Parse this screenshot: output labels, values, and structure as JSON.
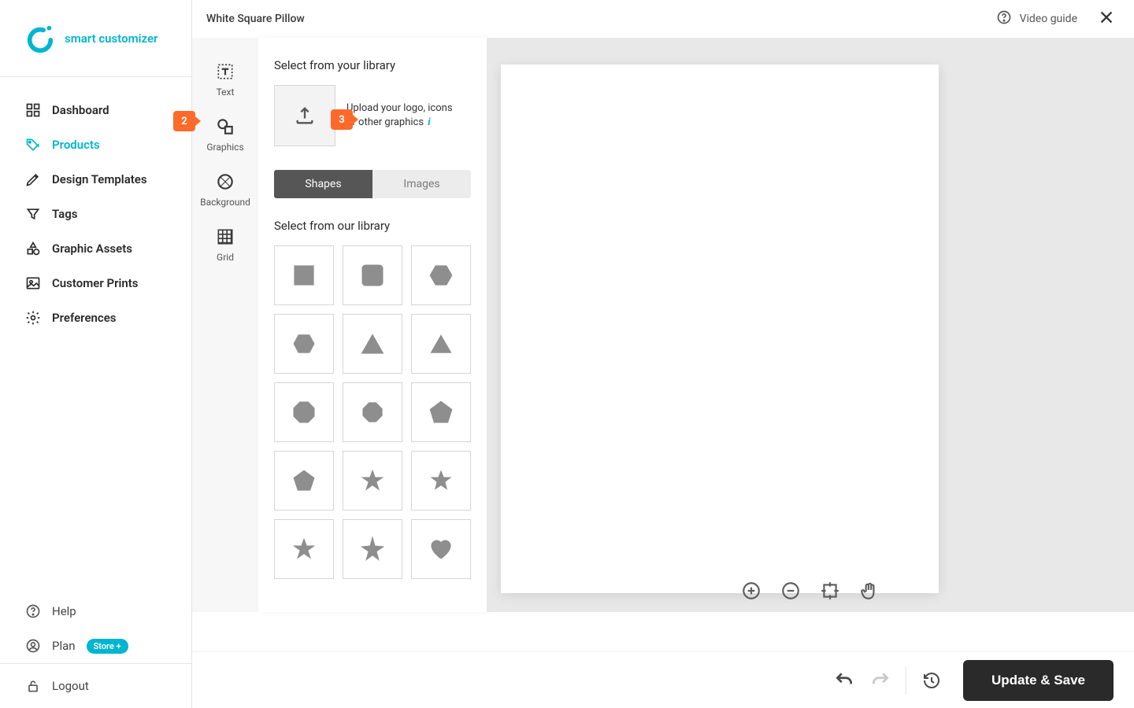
{
  "brand": {
    "name": "smart customizer"
  },
  "nav": {
    "items": [
      {
        "label": "Dashboard"
      },
      {
        "label": "Products"
      },
      {
        "label": "Design Templates"
      },
      {
        "label": "Tags"
      },
      {
        "label": "Graphic Assets"
      },
      {
        "label": "Customer Prints"
      },
      {
        "label": "Preferences"
      }
    ],
    "active_index": 1
  },
  "footer": {
    "help": "Help",
    "plan": "Plan",
    "plan_badge": "Store +",
    "logout": "Logout"
  },
  "topbar": {
    "title": "White Square Pillow",
    "video_guide": "Video guide"
  },
  "tools": [
    {
      "label": "Text"
    },
    {
      "label": "Graphics"
    },
    {
      "label": "Background"
    },
    {
      "label": "Grid"
    }
  ],
  "graphics_panel": {
    "library_heading": "Select from your library",
    "upload_line1": "Upload your logo, icons",
    "upload_line2": "or other graphics",
    "tab_shapes": "Shapes",
    "tab_images": "Images",
    "our_library_heading": "Select from our library"
  },
  "shapes": [
    "square",
    "rounded-square",
    "hexagon",
    "hexagon-alt",
    "triangle",
    "triangle-alt",
    "octagon",
    "octagon-alt",
    "pentagon",
    "pentagon-alt",
    "star5",
    "star5-alt",
    "star5-solid",
    "star-outline",
    "heart"
  ],
  "bottom": {
    "save": "Update & Save"
  },
  "badges": {
    "two": "2",
    "three": "3"
  }
}
